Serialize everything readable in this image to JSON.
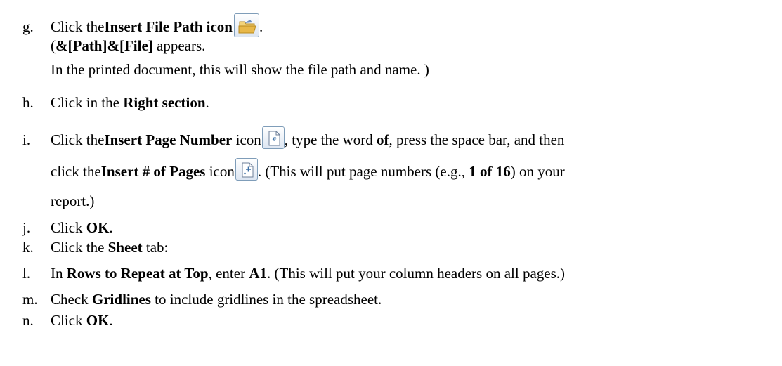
{
  "steps": {
    "g": {
      "letter": "g.",
      "line1": {
        "t1": "Click the ",
        "b1": "Insert File Path icon",
        "t2": "."
      },
      "line2": {
        "t1": "(",
        "b1": "&[Path]&[File]",
        "t2": " appears."
      },
      "line3": "In the printed document, this will show the file path and name. )",
      "icon": "insert-file-path-icon"
    },
    "h": {
      "letter": "h.",
      "t1": "Click in the ",
      "b1": "Right section",
      "t2": "."
    },
    "i": {
      "letter": "i.",
      "line1": {
        "t1": "Click the ",
        "b1": "Insert Page Number",
        "t2": " icon",
        "t3": ", type the word ",
        "b2": "of",
        "t4": ", press the space bar, and then"
      },
      "line2": {
        "t1": "click the ",
        "b1": "Insert # of Pages",
        "t2": " icon",
        "t3": ".  (This will put page numbers (e.g., ",
        "b2": "1 of 16",
        "t4": ") on your"
      },
      "line3": "report.)",
      "icon1": "insert-page-number-icon",
      "icon2": "insert-number-of-pages-icon"
    },
    "j": {
      "letter": "j.",
      "t1": "Click ",
      "b1": "OK",
      "t2": "."
    },
    "k": {
      "letter": "k.",
      "t1": "Click the ",
      "b1": "Sheet",
      "t2": " tab:"
    },
    "l": {
      "letter": "l.",
      "t1": "In ",
      "b1": "Rows to Repeat at Top",
      "t2": ", enter ",
      "b2": "A1",
      "t3": ". (This will put your column headers on all pages.)"
    },
    "m": {
      "letter": "m.",
      "t1": "Check ",
      "b1": "Gridlines",
      "t2": " to include gridlines in the spreadsheet."
    },
    "n": {
      "letter": "n.",
      "t1": "Click ",
      "b1": "OK",
      "t2": "."
    }
  },
  "colors": {
    "icon_border": "#7f9db9",
    "folder": "#e8b84a",
    "page_accent": "#3a6ea5"
  }
}
